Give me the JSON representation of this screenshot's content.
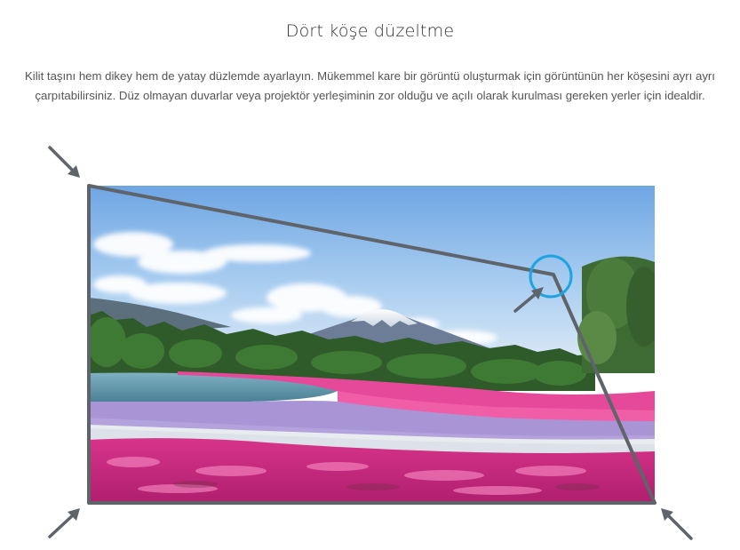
{
  "page": {
    "title": "Dört köşe düzeltme",
    "description": "Kilit taşını hem dikey hem de yatay düzlemde ayarlayın. Mükemmel kare bir görüntü oluşturmak için görüntünün her köşesini ayrı ayrı çarpıtabilirsiniz. Düz olmayan duvarlar veya projektör yerleşiminin zor olduğu ve açılı olarak kurulması gereken yerler için idealdir."
  },
  "illustration": {
    "subject": "mount-fuji-flower-field-photo",
    "colors": {
      "frame": "#5f646b",
      "arrow": "#5f646b",
      "highlight_ring": "#1ea3e3",
      "sky_top": "#7fb2e6",
      "sky_bottom": "#c8def3",
      "lake": "#5f95a8",
      "flowers_pink": "#e0408e",
      "flowers_purple": "#a48ad0",
      "flowers_white": "#eef0f2",
      "trees": "#36652f"
    },
    "icons": [
      "top-left-arrow-icon",
      "bottom-left-arrow-icon",
      "bottom-right-arrow-icon",
      "inner-corner-arrow-icon",
      "highlight-circle-icon"
    ]
  }
}
